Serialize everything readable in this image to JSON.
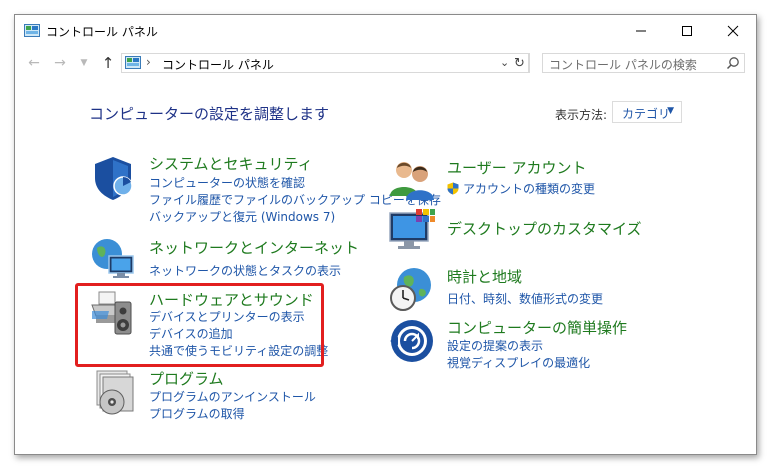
{
  "window": {
    "title": "コントロール パネル"
  },
  "nav": {
    "address": "コントロール パネル",
    "search_placeholder": "コントロール パネルの検索"
  },
  "main": {
    "heading": "コンピューターの設定を調整します",
    "view_by_label": "表示方法:",
    "view_by_value": "カテゴリ"
  },
  "categories": [
    {
      "title": "システムとセキュリティ",
      "icon": "shield-icon",
      "links": [
        "コンピューターの状態を確認",
        "ファイル履歴でファイルのバックアップ コピーを保存",
        "バックアップと復元 (Windows 7)"
      ]
    },
    {
      "title": "ネットワークとインターネット",
      "icon": "network-globe-icon",
      "links": [
        "ネットワークの状態とタスクの表示"
      ]
    },
    {
      "title": "ハードウェアとサウンド",
      "icon": "printer-speaker-icon",
      "links": [
        "デバイスとプリンターの表示",
        "デバイスの追加",
        "共通で使うモビリティ設定の調整"
      ]
    },
    {
      "title": "プログラム",
      "icon": "programs-disc-icon",
      "links": [
        "プログラムのアンインストール",
        "プログラムの取得"
      ]
    },
    {
      "title": "ユーザー アカウント",
      "icon": "users-icon",
      "links": [
        "アカウントの種類の変更"
      ]
    },
    {
      "title": "デスクトップのカスタマイズ",
      "icon": "monitor-palette-icon",
      "links": []
    },
    {
      "title": "時計と地域",
      "icon": "clock-globe-icon",
      "links": [
        "日付、時刻、数値形式の変更"
      ]
    },
    {
      "title": "コンピューターの簡単操作",
      "icon": "ease-of-access-icon",
      "links": [
        "設定の提案の表示",
        "視覚ディスプレイの最適化"
      ]
    }
  ],
  "colors": {
    "title_green": "#1e7a1e",
    "link_blue": "#1f56a8",
    "heading_blue": "#1e3287",
    "highlight_red": "#e21f1f"
  }
}
